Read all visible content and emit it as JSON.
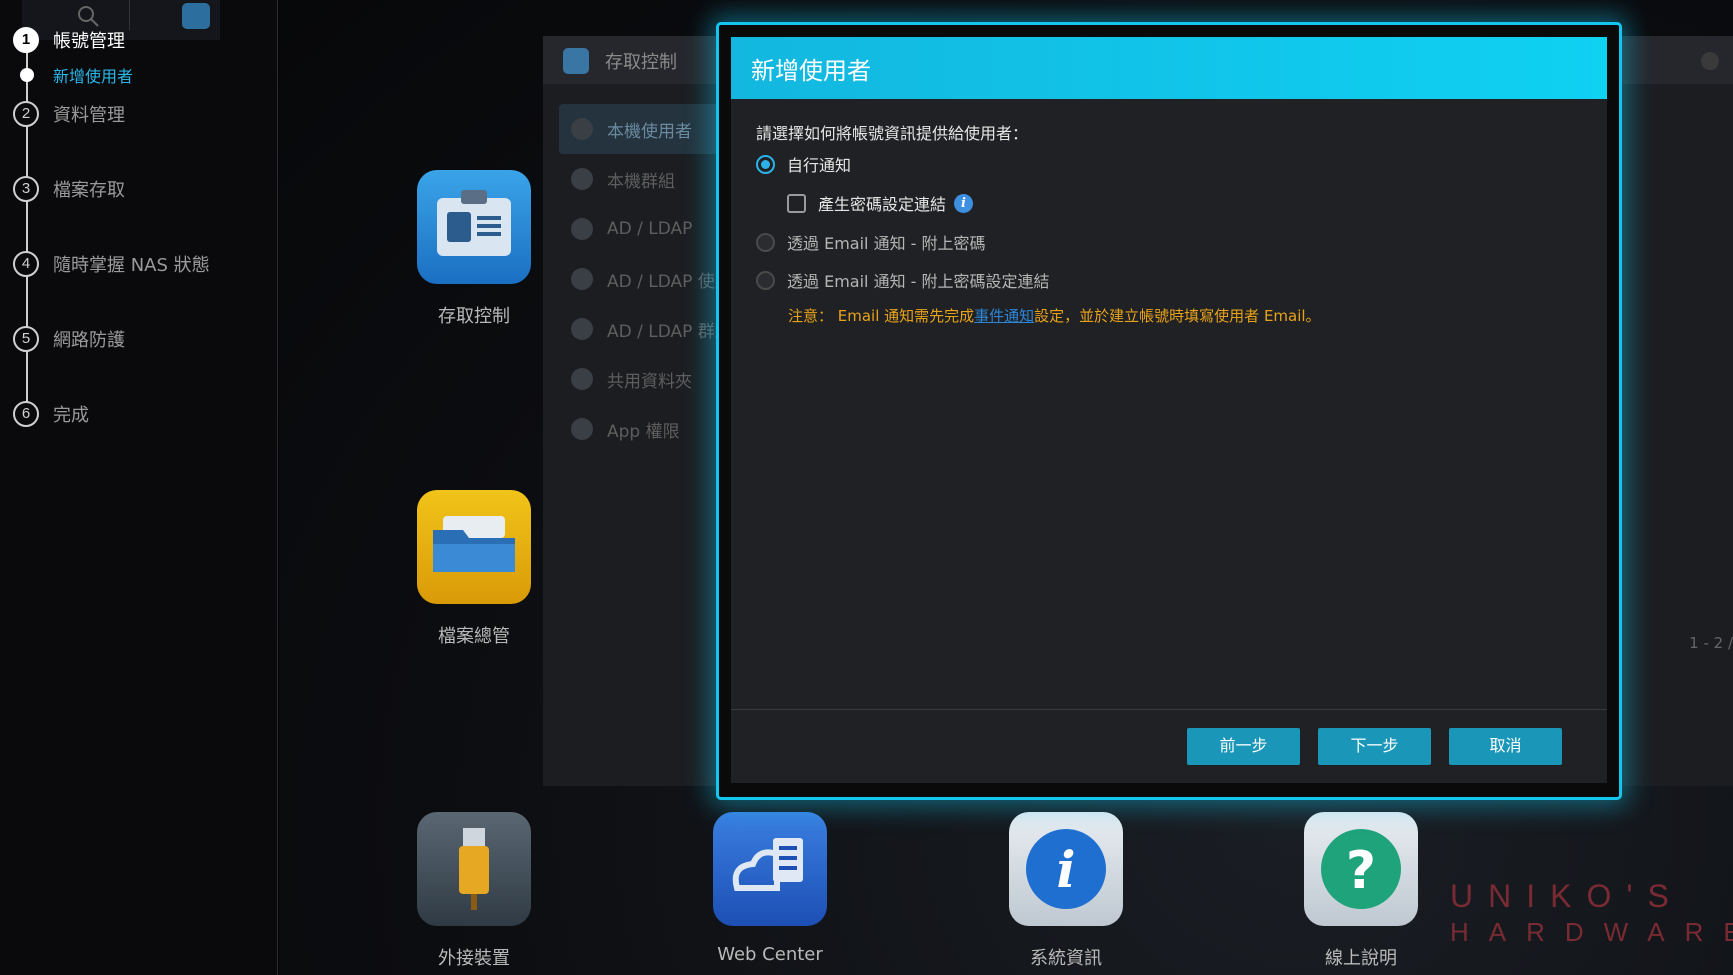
{
  "wizard": {
    "steps": [
      {
        "num": "1",
        "label": "帳號管理",
        "active": true
      },
      {
        "num": "2",
        "label": "資料管理"
      },
      {
        "num": "3",
        "label": "檔案存取"
      },
      {
        "num": "4",
        "label": "隨時掌握 NAS 狀態"
      },
      {
        "num": "5",
        "label": "網路防護"
      },
      {
        "num": "6",
        "label": "完成"
      }
    ],
    "substep": "新增使用者"
  },
  "desktop": {
    "icons": [
      {
        "label": "存取控制"
      },
      {
        "label": "檔案總管"
      },
      {
        "label": "外接裝置"
      },
      {
        "label": "Web Center"
      },
      {
        "label": "系統資訊"
      },
      {
        "label": "線上說明"
      }
    ]
  },
  "background_window": {
    "title": "存取控制",
    "nav": [
      "本機使用者",
      "本機群組",
      "AD / LDAP",
      "AD / LDAP 使用",
      "AD / LDAP 群組",
      "共用資料夾",
      "App 權限"
    ],
    "pager": "1 - 2 /"
  },
  "modal": {
    "title": "新增使用者",
    "prompt": "請選擇如何將帳號資訊提供給使用者：",
    "options": [
      {
        "label": "自行通知",
        "selected": true
      },
      {
        "label": "產生密碼設定連結",
        "checked": false
      },
      {
        "label": "透過 Email 通知 - 附上密碼",
        "selected": false
      },
      {
        "label": "透過 Email 通知 - 附上密碼設定連結",
        "selected": false
      }
    ],
    "note_prefix": "注意： Email 通知需先完成",
    "note_link": "事件通知",
    "note_suffix": "設定，並於建立帳號時填寫使用者 Email。",
    "buttons": {
      "prev": "前一步",
      "next": "下一步",
      "cancel": "取消"
    }
  },
  "watermark": {
    "line1": "UNIKO'S",
    "line2": "HARDWARE"
  },
  "colors": {
    "accent": "#13c6ef",
    "button": "#1a96b8",
    "warning": "#e8a21a",
    "link": "#2d86d8",
    "substep": "#29b6e6"
  }
}
